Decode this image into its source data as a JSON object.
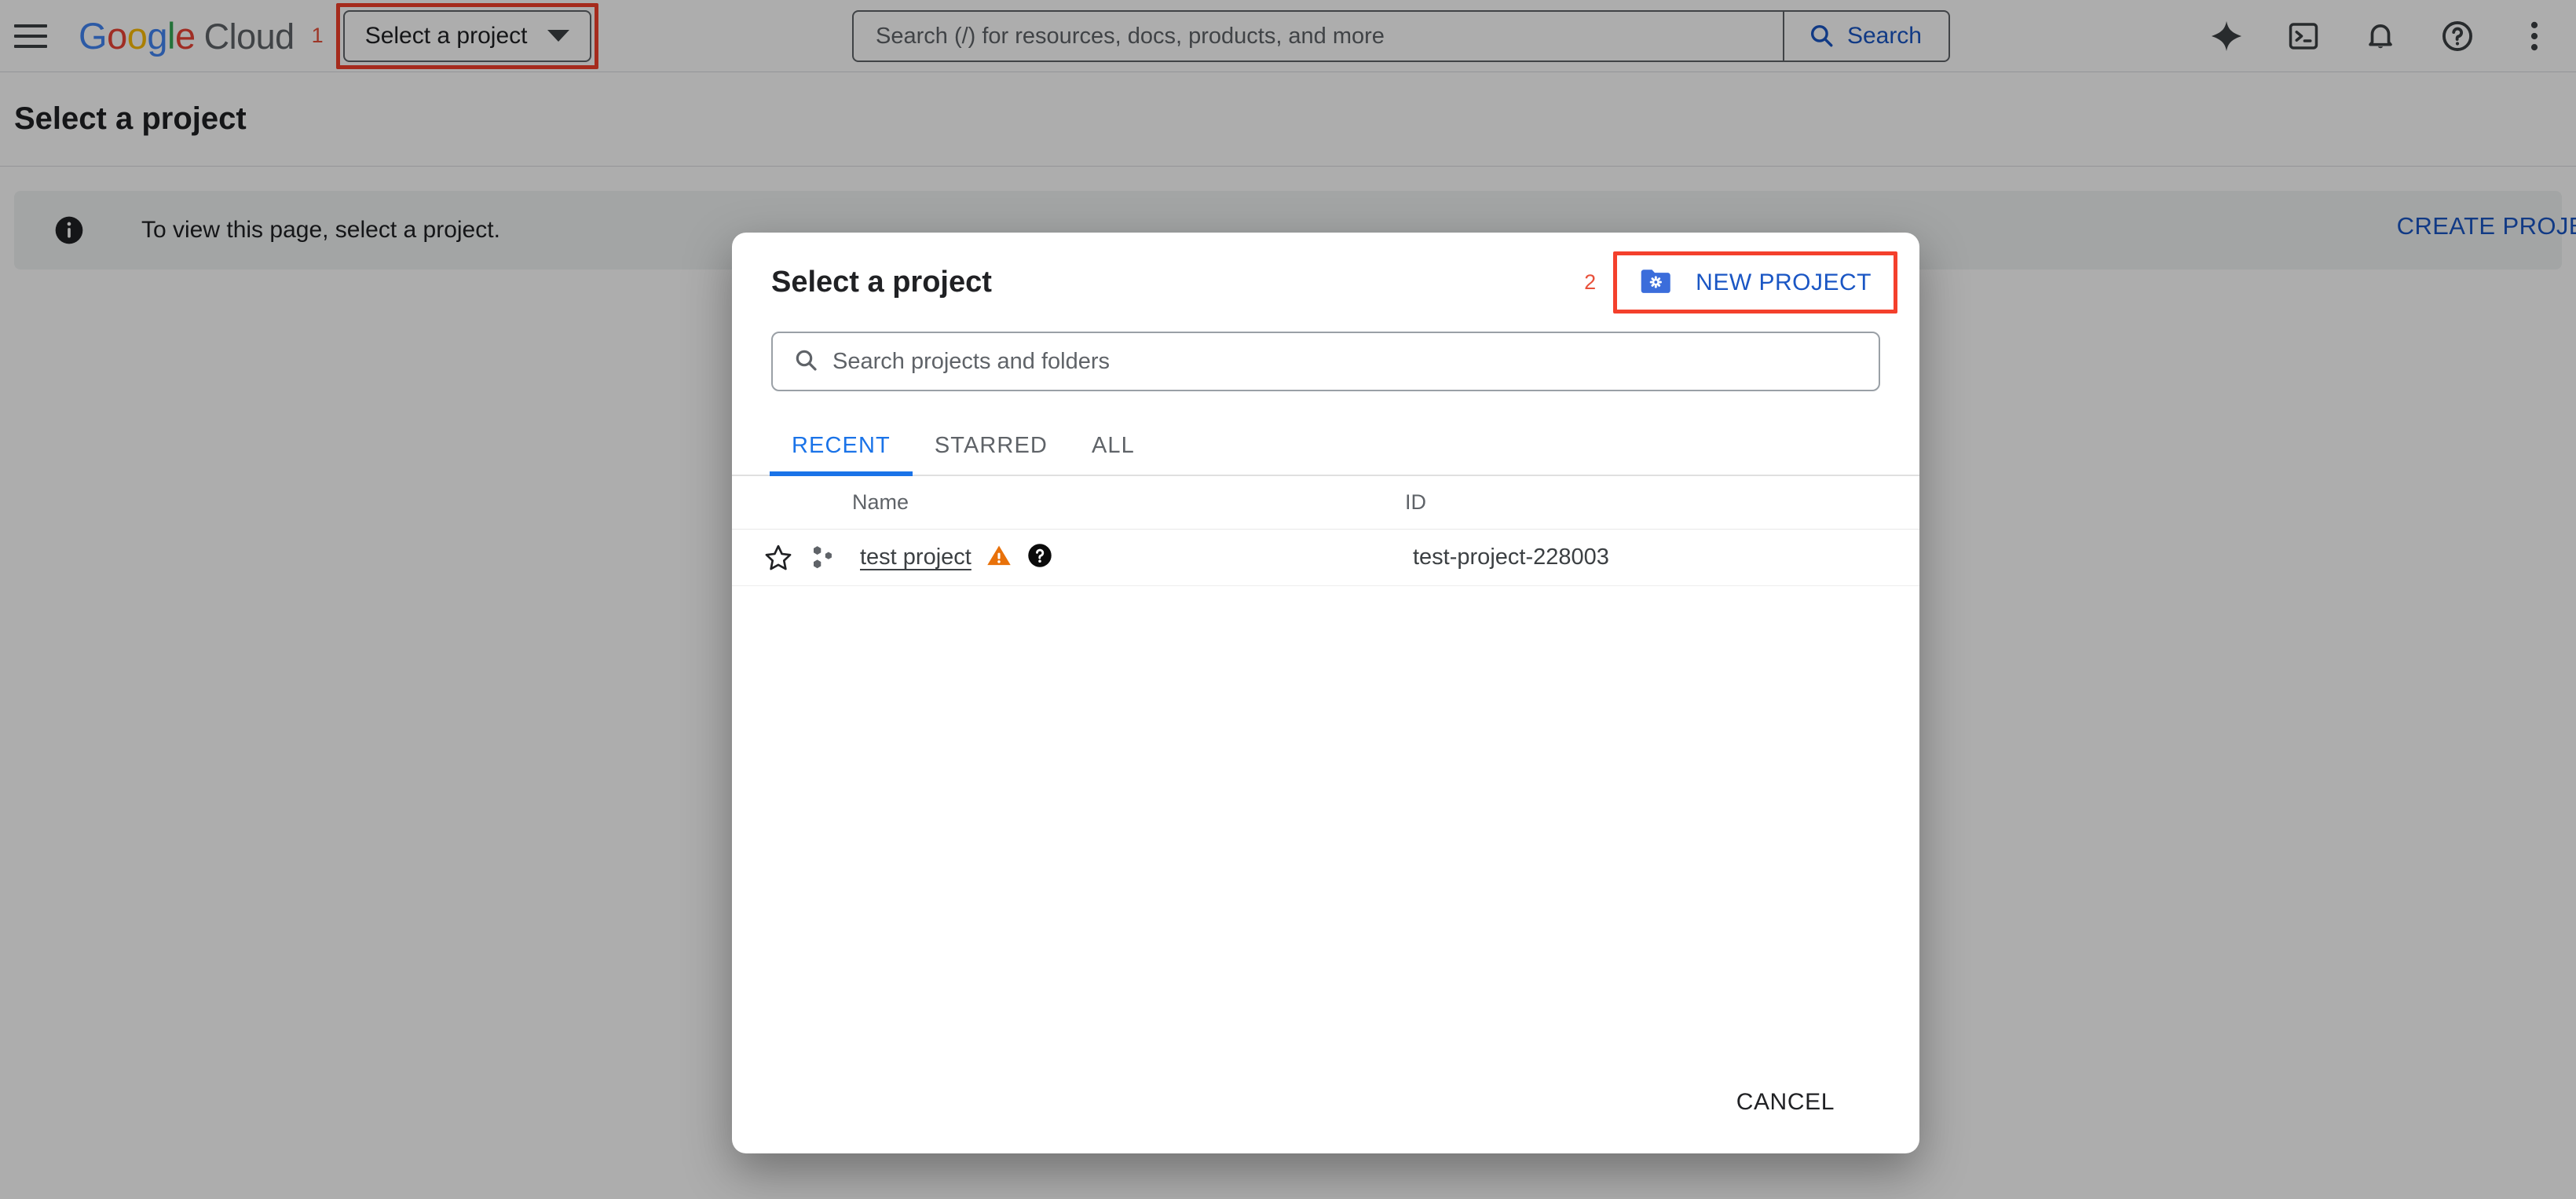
{
  "topbar": {
    "menu_icon": "hamburger-menu-icon",
    "logo": {
      "google": "Google",
      "cloud": "Cloud"
    },
    "step_marker_1": "1",
    "project_picker_label": "Select a project",
    "search": {
      "placeholder": "Search (/) for resources, docs, products, and more",
      "value": "",
      "button_label": "Search",
      "icon": "search-icon"
    },
    "icons": [
      {
        "name": "gemini-sparkle-icon"
      },
      {
        "name": "cloud-shell-terminal-icon"
      },
      {
        "name": "notifications-bell-icon"
      },
      {
        "name": "help-circle-icon"
      },
      {
        "name": "more-vert-icon"
      }
    ]
  },
  "page": {
    "title": "Select a project",
    "banner": {
      "icon": "info-icon",
      "text": "To view this page, select a project.",
      "action_label": "CREATE PROJECT"
    }
  },
  "dialog": {
    "title": "Select a project",
    "step_marker_2": "2",
    "new_project_label": "NEW PROJECT",
    "new_project_icon": "create-new-folder-icon",
    "search": {
      "placeholder": "Search projects and folders",
      "value": "",
      "icon": "search-icon"
    },
    "tabs": [
      {
        "label": "RECENT",
        "active": true
      },
      {
        "label": "STARRED",
        "active": false
      },
      {
        "label": "ALL",
        "active": false
      }
    ],
    "columns": {
      "name": "Name",
      "id": "ID"
    },
    "rows": [
      {
        "star_icon": "star-outline-icon",
        "project_icon": "project-hexagons-icon",
        "name": "test project",
        "warning_icon": "warning-triangle-icon",
        "help_icon": "help-filled-icon",
        "id": "test-project-228003"
      }
    ],
    "cancel_label": "CANCEL"
  },
  "colors": {
    "accent_blue": "#1a73e8",
    "link_blue": "#1a56c4",
    "annotation_red": "#f4402c",
    "warning_orange": "#e8710a",
    "text_primary": "#202124",
    "text_secondary": "#5f6368"
  }
}
